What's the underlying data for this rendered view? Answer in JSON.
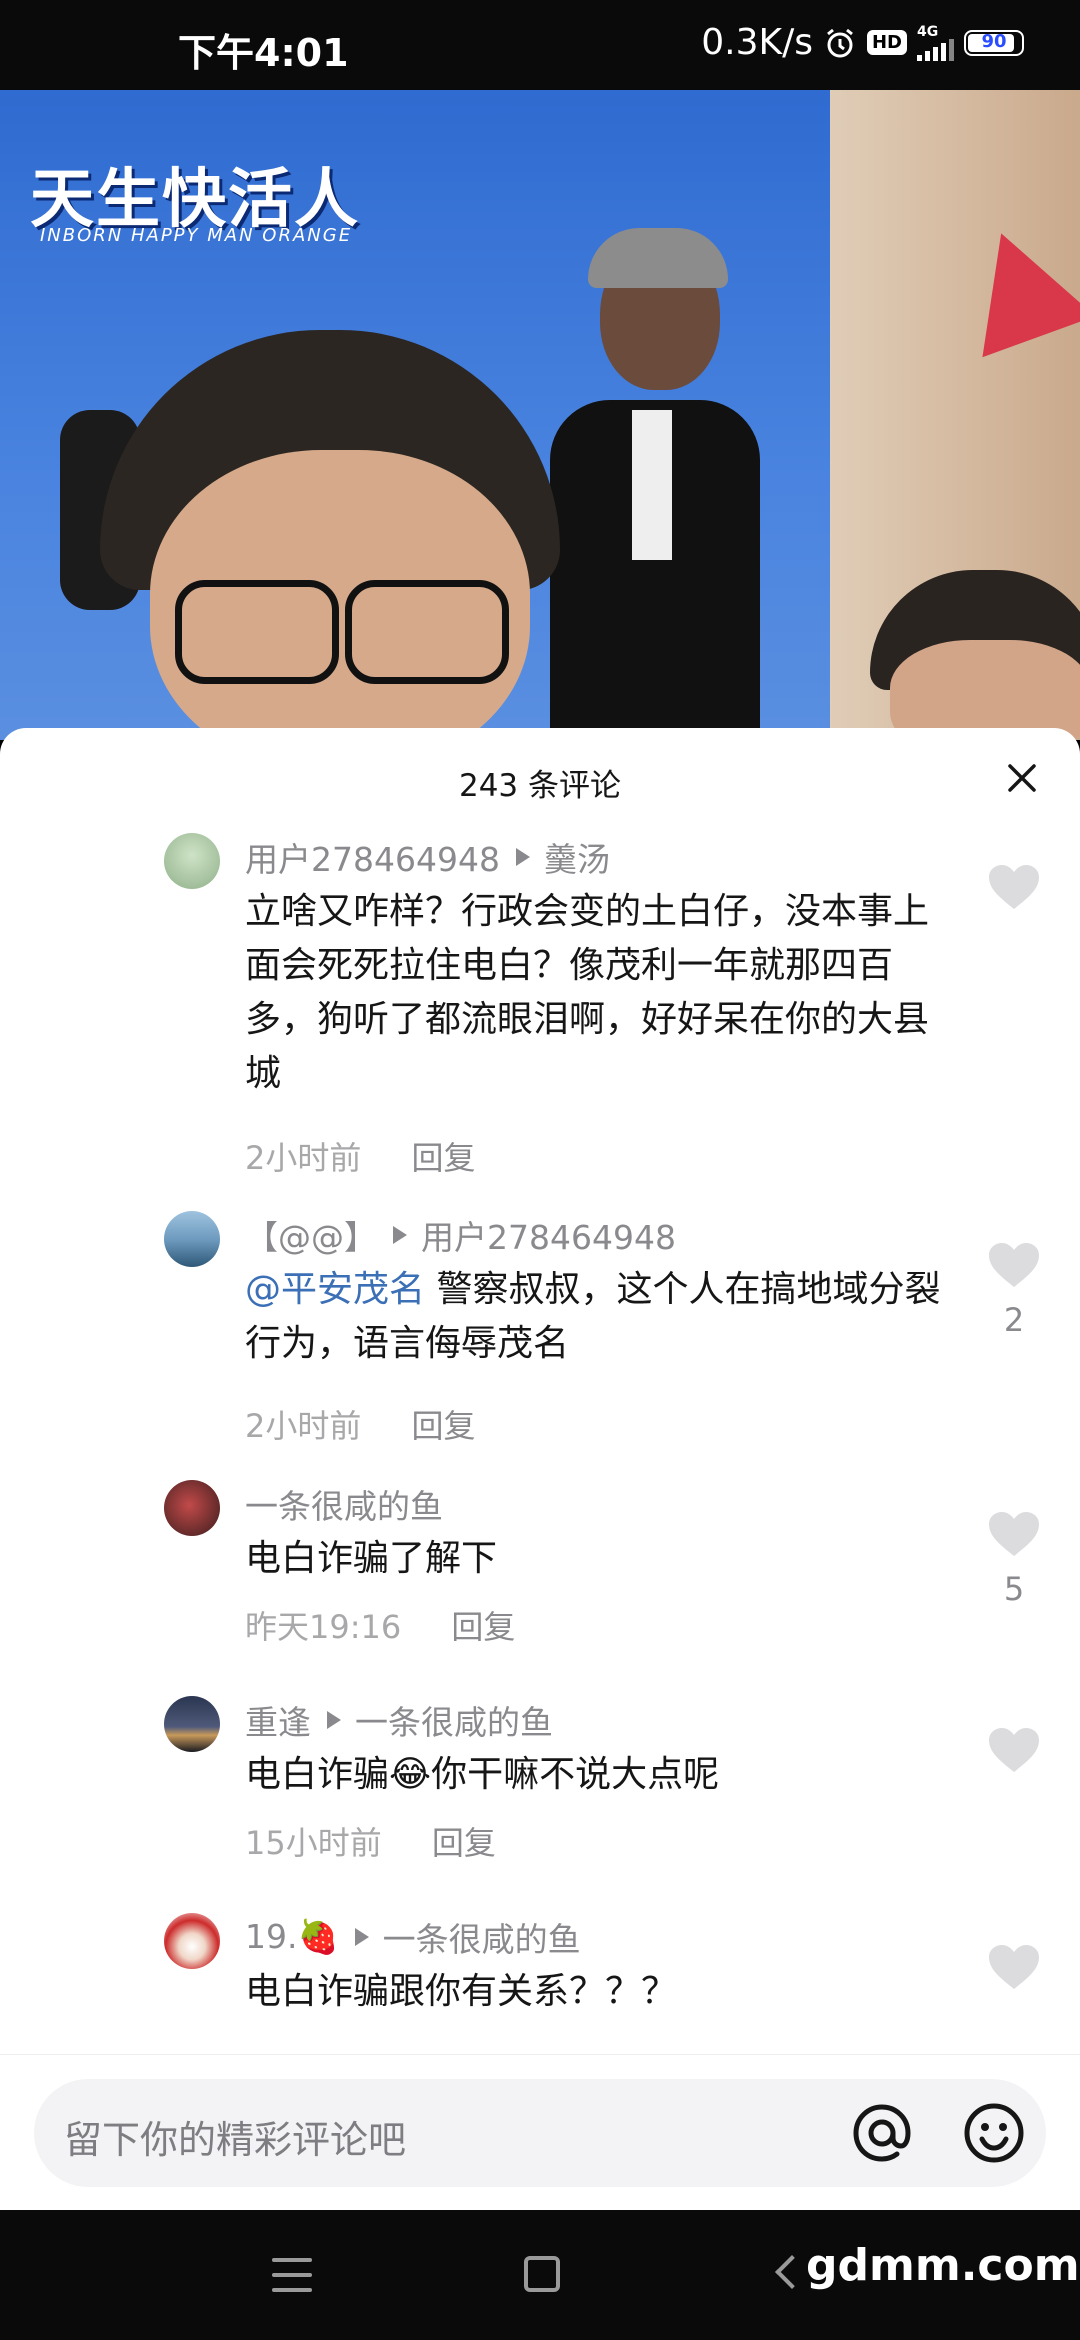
{
  "status_bar": {
    "time": "下午4:01",
    "speed": "0.3K/s",
    "hd": "HD",
    "network": "4G",
    "battery": "90"
  },
  "comments_sheet": {
    "title": "243 条评论",
    "close_icon": "close-icon",
    "comments": [
      {
        "user": "用户278464948",
        "reply_to": "羹汤",
        "text": "立啥又咋样？行政会变的土白仔，没本事上面会死死拉住电白？像茂利一年就那四百多，狗听了都流眼泪啊，好好呆在你的大县城",
        "time": "2小时前",
        "reply_label": "回复",
        "likes": ""
      },
      {
        "user": "【@@】",
        "reply_to": "用户278464948",
        "mention": "@平安茂名",
        "text": " 警察叔叔，这个人在搞地域分裂行为，语言侮辱茂名",
        "time": "2小时前",
        "reply_label": "回复",
        "likes": "2"
      },
      {
        "user": "一条很咸的鱼",
        "reply_to": "",
        "text": "电白诈骗了解下",
        "time": "昨天19:16",
        "reply_label": "回复",
        "likes": "5"
      },
      {
        "user": "重逢",
        "reply_to": "一条很咸的鱼",
        "text": "电白诈骗😂你干嘛不说大点呢",
        "time": "15小时前",
        "reply_label": "回复",
        "likes": ""
      },
      {
        "user": "19.🍓",
        "reply_to": "一条很咸的鱼",
        "text": "电白诈骗跟你有关系？？？",
        "time": "",
        "reply_label": "",
        "likes": ""
      }
    ]
  },
  "input_bar": {
    "placeholder": "留下你的精彩评论吧",
    "at_icon": "at-icon",
    "emoji_icon": "emoji-icon"
  },
  "nav_bar": {
    "watermark": "gdmm.com"
  },
  "video": {
    "poster_title": "天生快活人",
    "poster_subtitle": "INBORN HAPPY MAN ORANGE"
  }
}
